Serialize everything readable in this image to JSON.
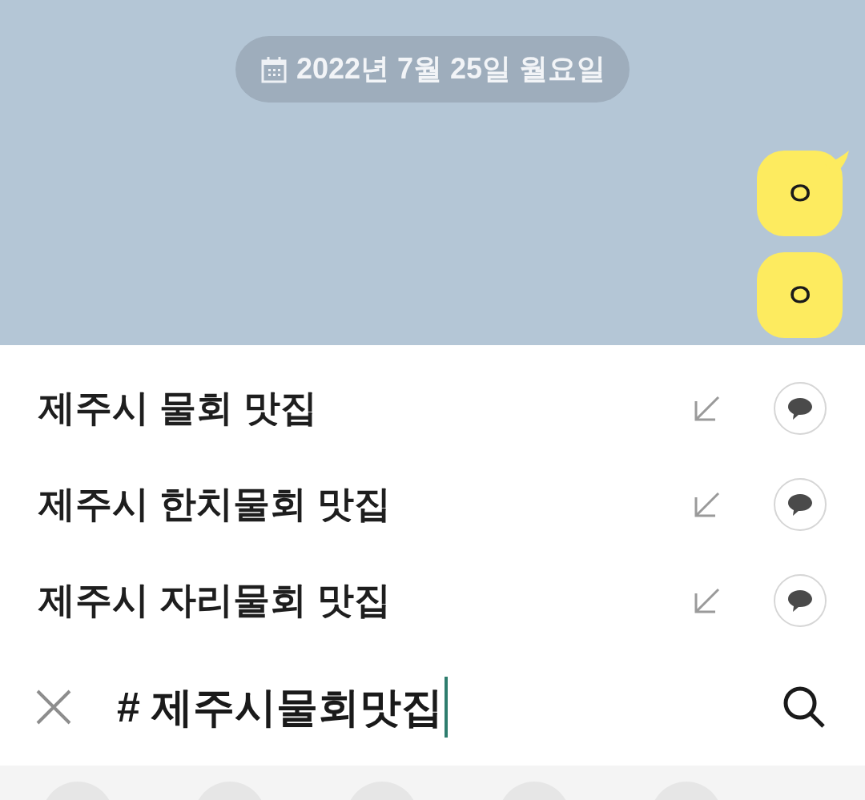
{
  "chat": {
    "date": "2022년 7월 25일 월요일",
    "messages": [
      {
        "text": "ㅇ",
        "tail": true
      },
      {
        "text": "ㅇ",
        "tail": false
      }
    ]
  },
  "suggestions": [
    {
      "text": "제주시 물회 맛집"
    },
    {
      "text": "제주시 한치물회 맛집"
    },
    {
      "text": "제주시 자리물회 맛집"
    }
  ],
  "search": {
    "value": "# 제주시물회맛집"
  }
}
